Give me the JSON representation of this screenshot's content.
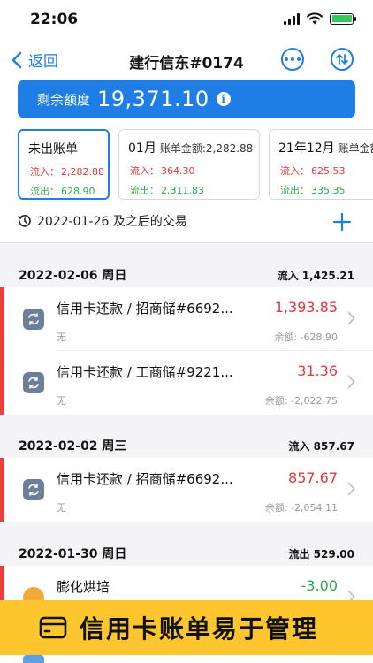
{
  "status": {
    "time": "22:06"
  },
  "nav": {
    "back_label": "返回",
    "title": "建行信东#0174"
  },
  "limit": {
    "label": "剩余额度",
    "value": "19,371.10",
    "info": "i"
  },
  "bills": [
    {
      "title": "未出账单",
      "sub": "",
      "in_label": "流入：",
      "in_value": "2,282.88",
      "out_label": "流出：",
      "out_value": "628.90"
    },
    {
      "title": "01月",
      "sub": "账单金额:2,282.88",
      "in_label": "流入：",
      "in_value": "364.30",
      "out_label": "流出：",
      "out_value": "2,311.83"
    },
    {
      "title": "21年12月",
      "sub": "账单金额",
      "in_label": "流入：",
      "in_value": "625.53",
      "out_label": "流出：",
      "out_value": "335.35"
    }
  ],
  "since": {
    "label": "2022-01-26 及之后的交易"
  },
  "groups": [
    {
      "date": "2022-02-06 周日",
      "sum": "流入 1,425.21",
      "transactions": [
        {
          "name": "信用卡还款 / 招商储#6692...",
          "note": "无",
          "amount": "1,393.85",
          "balance": "余额: -628.90"
        },
        {
          "name": "信用卡还款 / 工商储#9221...",
          "note": "无",
          "amount": "31.36",
          "balance": "余额: -2,022.75"
        }
      ]
    },
    {
      "date": "2022-02-02 周三",
      "sum": "流入 857.67",
      "transactions": [
        {
          "name": "信用卡还款 / 招商储#6692...",
          "note": "无",
          "amount": "857.67",
          "balance": "余额: -2,054.11"
        }
      ]
    },
    {
      "date": "2022-01-30 周日",
      "sum": "流出 529.00",
      "transactions": [
        {
          "name": "膨化烘培",
          "note": "",
          "amount": "-3.00",
          "balance": ""
        }
      ]
    }
  ],
  "banner": {
    "text": "信用卡账单易于管理"
  },
  "colors": {
    "accent": "#1e7ee6",
    "inflow": "#e0383e",
    "outflow": "#2fa84f",
    "banner": "#fdc62f"
  }
}
